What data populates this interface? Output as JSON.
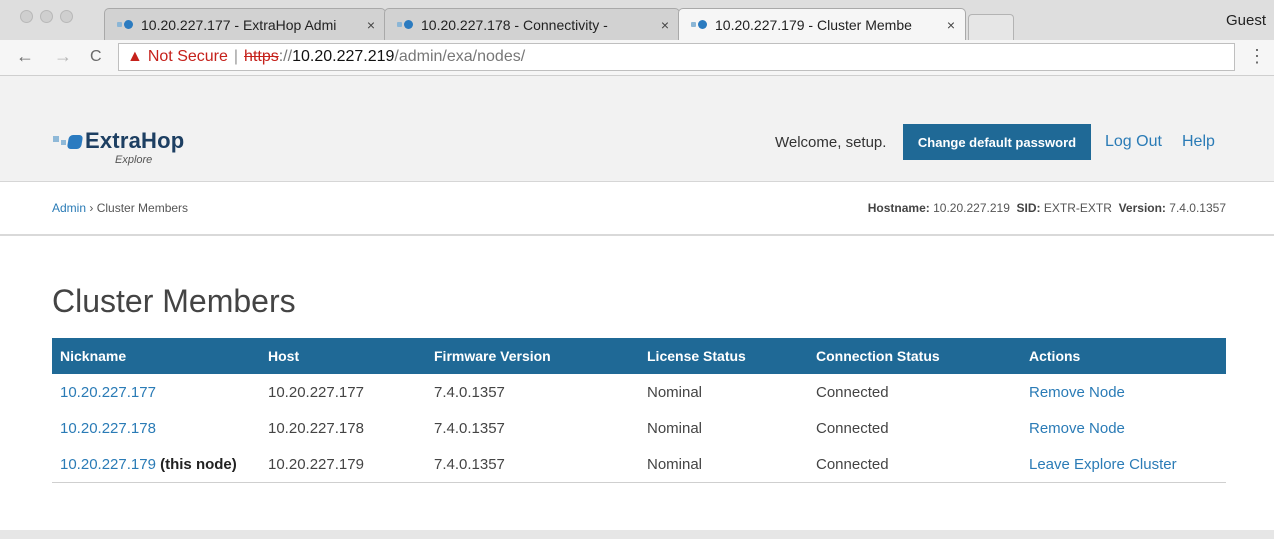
{
  "browser": {
    "tabs": [
      {
        "title": "10.20.227.177 - ExtraHop Admi"
      },
      {
        "title": "10.20.227.178 - Connectivity -"
      },
      {
        "title": "10.20.227.179 - Cluster Membe"
      }
    ],
    "tab_close": "×",
    "profile": "Guest",
    "address": {
      "warning": "Not Secure",
      "separator": "|",
      "scheme": "https",
      "scheme_sep": "://",
      "host": "10.20.227.219",
      "path": "/admin/exa/nodes/"
    },
    "icons": {
      "back": "←",
      "forward": "→",
      "reload": "C",
      "warning": "▲",
      "menu": "⋮"
    }
  },
  "header": {
    "brand": "ExtraHop",
    "brand_sub": "Explore",
    "welcome": "Welcome, setup.",
    "change_password": "Change default password",
    "logout": "Log Out",
    "help": "Help"
  },
  "breadcrumb": {
    "root": "Admin",
    "sep": "›",
    "current": "Cluster Members"
  },
  "meta": {
    "hostname_label": "Hostname:",
    "hostname": "10.20.227.219",
    "sid_label": "SID:",
    "sid": "EXTR-EXTR",
    "version_label": "Version:",
    "version": "7.4.0.1357"
  },
  "main": {
    "title": "Cluster Members",
    "columns": [
      "Nickname",
      "Host",
      "Firmware Version",
      "License Status",
      "Connection Status",
      "Actions"
    ],
    "rows": [
      {
        "nickname": "10.20.227.177",
        "suffix": "",
        "host": "10.20.227.177",
        "firmware": "7.4.0.1357",
        "license": "Nominal",
        "connection": "Connected",
        "action": "Remove Node"
      },
      {
        "nickname": "10.20.227.178",
        "suffix": "",
        "host": "10.20.227.178",
        "firmware": "7.4.0.1357",
        "license": "Nominal",
        "connection": "Connected",
        "action": "Remove Node"
      },
      {
        "nickname": "10.20.227.179",
        "suffix": "(this node)",
        "host": "10.20.227.179",
        "firmware": "7.4.0.1357",
        "license": "Nominal",
        "connection": "Connected",
        "action": "Leave Explore Cluster"
      }
    ]
  }
}
